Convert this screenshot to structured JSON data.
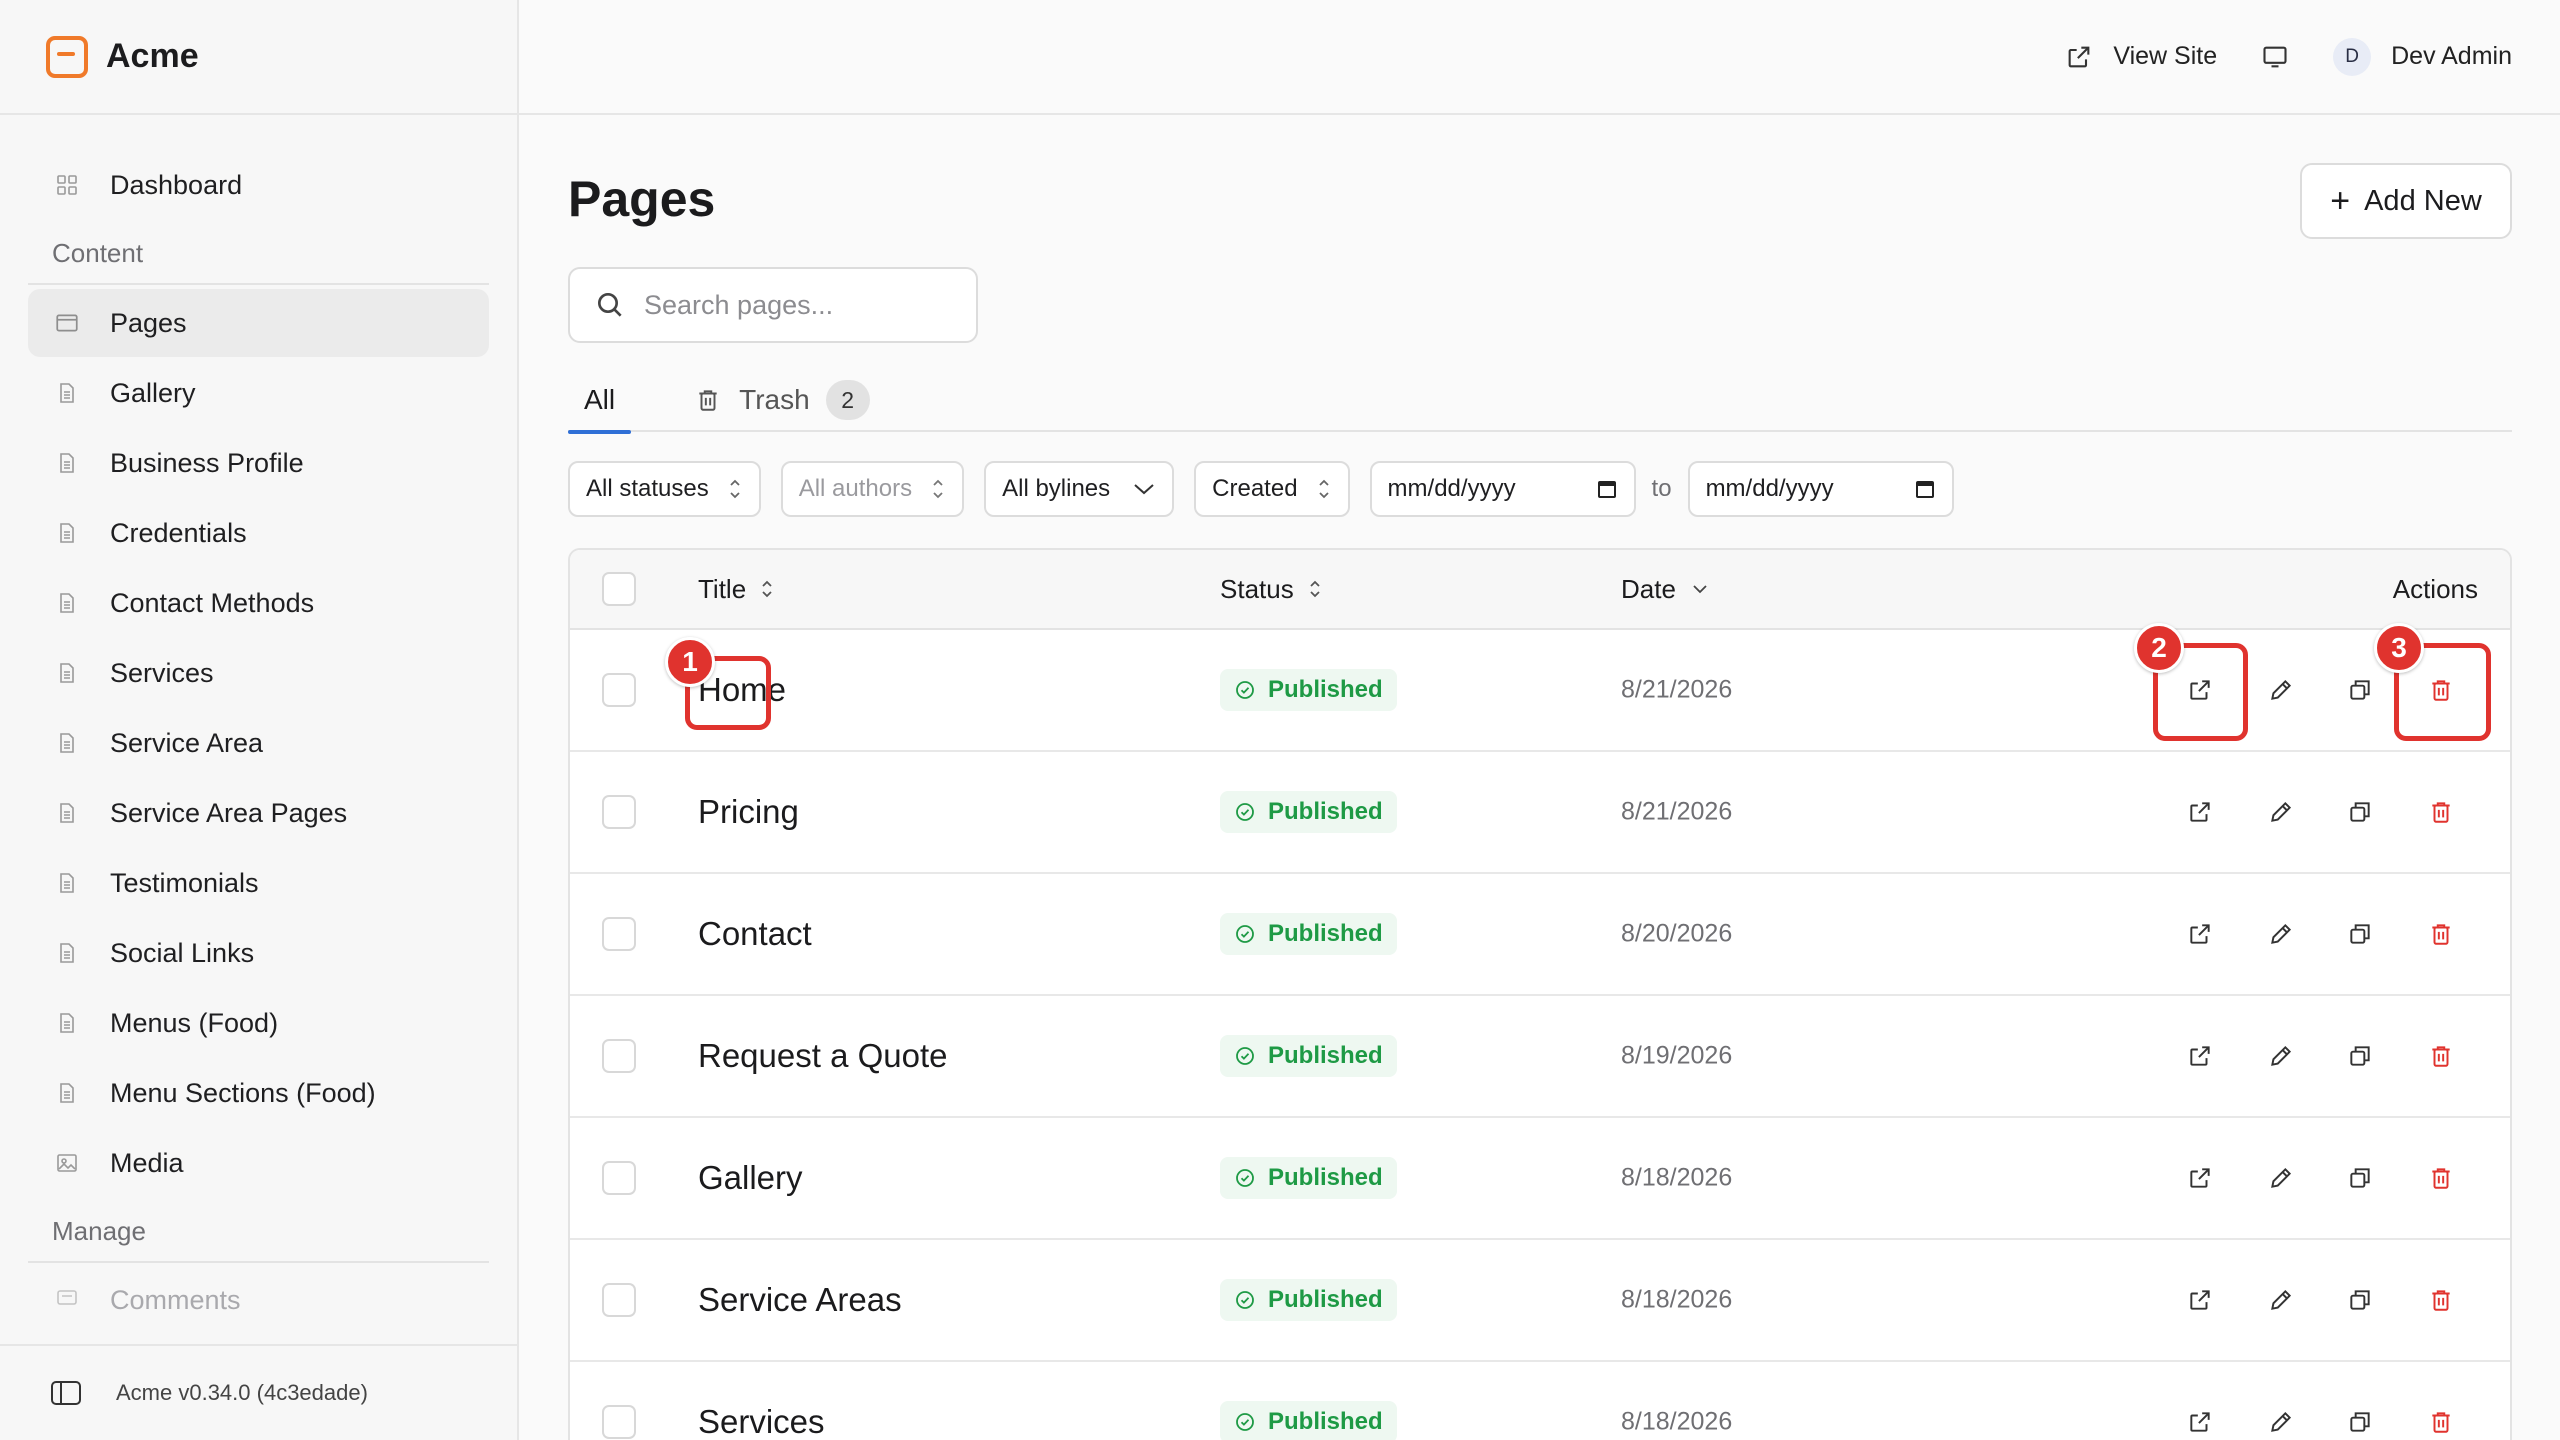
{
  "brand": {
    "name": "Acme",
    "accent": "#f07a2a"
  },
  "header": {
    "view_site": "View Site",
    "user_initial": "D",
    "user_name": "Dev Admin"
  },
  "sidebar": {
    "dashboard": "Dashboard",
    "content_section": "Content",
    "items": [
      {
        "label": "Pages",
        "icon": "window-icon",
        "active": true
      },
      {
        "label": "Gallery",
        "icon": "document-icon"
      },
      {
        "label": "Business Profile",
        "icon": "document-icon"
      },
      {
        "label": "Credentials",
        "icon": "document-icon"
      },
      {
        "label": "Contact Methods",
        "icon": "document-icon"
      },
      {
        "label": "Services",
        "icon": "document-icon"
      },
      {
        "label": "Service Area",
        "icon": "document-icon"
      },
      {
        "label": "Service Area Pages",
        "icon": "document-icon"
      },
      {
        "label": "Testimonials",
        "icon": "document-icon"
      },
      {
        "label": "Social Links",
        "icon": "document-icon"
      },
      {
        "label": "Menus (Food)",
        "icon": "document-icon"
      },
      {
        "label": "Menu Sections (Food)",
        "icon": "document-icon"
      },
      {
        "label": "Media",
        "icon": "image-icon"
      }
    ],
    "manage_section": "Manage",
    "comments": "Comments",
    "version": "Acme v0.34.0 (4c3edade)"
  },
  "main": {
    "title": "Pages",
    "add_new": "Add New",
    "search_placeholder": "Search pages...",
    "tabs": {
      "all": "All",
      "trash": "Trash",
      "trash_count": "2"
    },
    "filters": {
      "statuses": "All statuses",
      "authors": "All authors",
      "bylines": "All bylines",
      "sort": "Created",
      "date_from": "mm/dd/yyyy",
      "to": "to",
      "date_to": "mm/dd/yyyy"
    },
    "columns": {
      "title": "Title",
      "status": "Status",
      "date": "Date",
      "actions": "Actions"
    },
    "rows": [
      {
        "title": "Home",
        "status": "Published",
        "date": "8/21/2026"
      },
      {
        "title": "Pricing",
        "status": "Published",
        "date": "8/21/2026"
      },
      {
        "title": "Contact",
        "status": "Published",
        "date": "8/20/2026"
      },
      {
        "title": "Request a Quote",
        "status": "Published",
        "date": "8/19/2026"
      },
      {
        "title": "Gallery",
        "status": "Published",
        "date": "8/18/2026"
      },
      {
        "title": "Service Areas",
        "status": "Published",
        "date": "8/18/2026"
      },
      {
        "title": "Services",
        "status": "Published",
        "date": "8/18/2026"
      }
    ]
  },
  "annotations": {
    "m1": "1",
    "m2": "2",
    "m3": "3"
  },
  "colors": {
    "published": "#1e9a45",
    "delete": "#e0332e",
    "annotation": "#e0332e"
  }
}
